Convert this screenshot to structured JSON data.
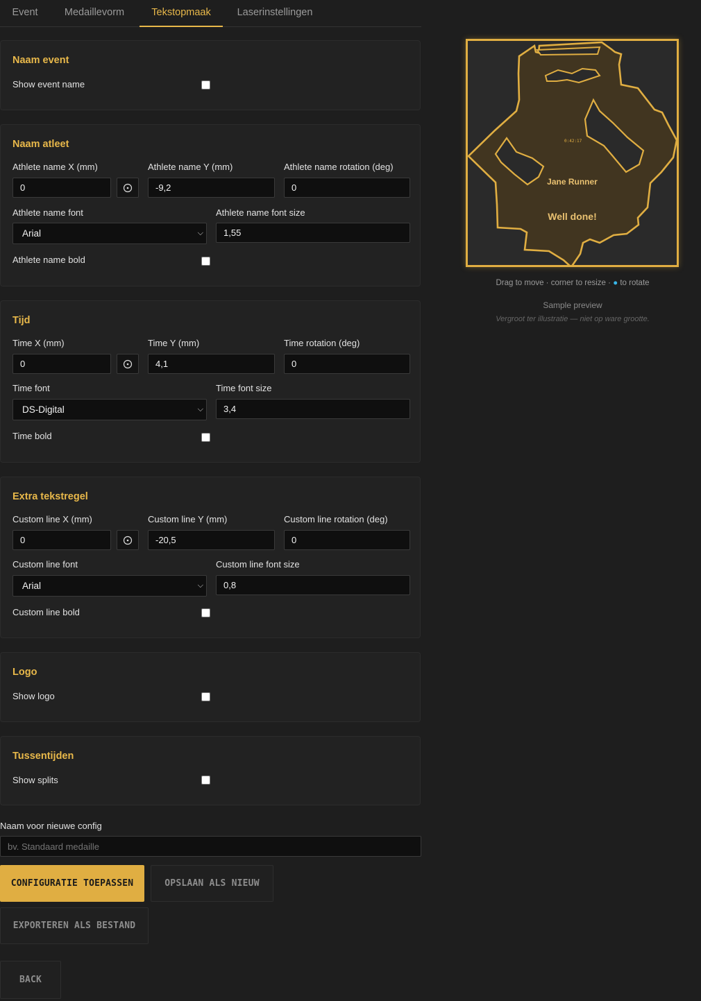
{
  "tabs": [
    "Event",
    "Medaillevorm",
    "Tekstopmaak",
    "Laserinstellingen"
  ],
  "sections": {
    "event_name": {
      "title": "Naam event",
      "show_label": "Show event name"
    },
    "athlete": {
      "title": "Naam atleet",
      "x_label": "Athlete name X (mm)",
      "x_value": "0",
      "y_label": "Athlete name Y (mm)",
      "y_value": "-9,2",
      "rot_label": "Athlete name rotation (deg)",
      "rot_value": "0",
      "font_label": "Athlete name font",
      "font_value": "Arial",
      "size_label": "Athlete name font size",
      "size_value": "1,55",
      "bold_label": "Athlete name bold"
    },
    "time": {
      "title": "Tijd",
      "x_label": "Time X (mm)",
      "x_value": "0",
      "y_label": "Time Y (mm)",
      "y_value": "4,1",
      "rot_label": "Time rotation (deg)",
      "rot_value": "0",
      "font_label": "Time font",
      "font_value": "DS-Digital",
      "size_label": "Time font size",
      "size_value": "3,4",
      "bold_label": "Time bold"
    },
    "custom": {
      "title": "Extra tekstregel",
      "x_label": "Custom line X (mm)",
      "x_value": "0",
      "y_label": "Custom line Y (mm)",
      "y_value": "-20,5",
      "rot_label": "Custom line rotation (deg)",
      "rot_value": "0",
      "font_label": "Custom line font",
      "font_value": "Arial",
      "size_label": "Custom line font size",
      "size_value": "0,8",
      "bold_label": "Custom line bold"
    },
    "logo": {
      "title": "Logo",
      "show_label": "Show logo"
    },
    "splits": {
      "title": "Tussentijden",
      "show_label": "Show splits"
    }
  },
  "config": {
    "name_label": "Naam voor nieuwe config",
    "name_placeholder": "bv. Standaard medaille"
  },
  "buttons": {
    "apply": "CONFIGURATIE TOEPASSEN",
    "save_new": "OPSLAAN ALS NIEUW",
    "export": "EXPORTEREN ALS BESTAND",
    "back": "BACK"
  },
  "preview": {
    "time_text": "0:42:17",
    "athlete_text": "Jane Runner",
    "custom_text": "Well done!",
    "hint_part1": "Drag to move · corner to resize · ",
    "hint_part2": " to rotate",
    "sample_label": "Sample preview",
    "note": "Vergroot ter illustratie — niet op ware grootte."
  },
  "colors": {
    "accent": "#e0ae42",
    "rotate_dot": "#38b6e8"
  }
}
